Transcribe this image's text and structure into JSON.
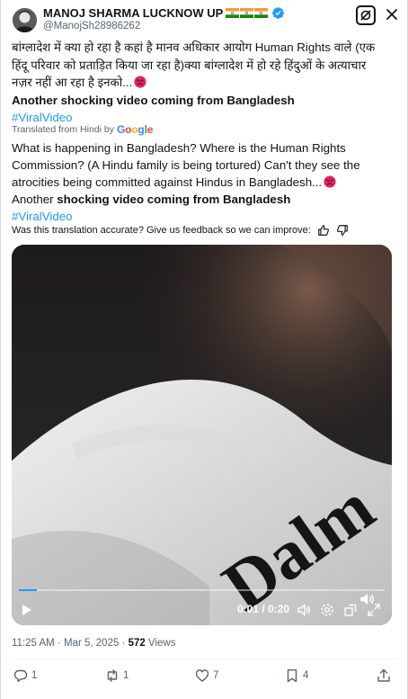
{
  "header": {
    "display_name": "MANOJ SHARMA LUCKNOW UP",
    "handle": "@ManojSh28986262",
    "avatar_icon": "profile-photo",
    "verified_icon": "verified-badge-icon",
    "grok_icon": "grok-icon",
    "close_icon": "close-icon"
  },
  "post": {
    "original_text": "बांग्लादेश में क्या हो रहा है कहां है मानव अधिकार आयोग Human Rights वाले (एक\nहिंदू परिवार को प्रताड़ित किया जा रहा है)क्या बांग्लादेश में हो रहे हिंदुओं के अत्याचार\nनज़र नहीं आ रहा है इनको...",
    "original_bold": "Another shocking video coming from Bangladesh",
    "original_hashtag": "#ViralVideo",
    "translated_prefix": "Translated from Hindi by",
    "translated_by": "Google",
    "translated_text": "What is happening in Bangladesh? Where is the Human Rights\nCommission? (A Hindu family is being tortured) Can't they see the\natrocities being committed against Hindus in Bangladesh...",
    "translated_line_start": "Another ",
    "translated_bold": "shocking video coming from Bangladesh",
    "translated_hashtag": "#ViralVideo",
    "feedback_prompt": "Was this translation accurate? Give us feedback so we can improve:"
  },
  "video": {
    "time_display": "0:01 / 0:20",
    "progress": 0.05,
    "overlay_text": "Dalm"
  },
  "meta": {
    "time": "11:25 AM",
    "date": "Mar 5, 2025",
    "separator": "·",
    "views_count": "572",
    "views_label": "Views"
  },
  "actions": {
    "replies": "1",
    "reposts": "1",
    "likes": "7",
    "bookmarks": "4"
  },
  "colors": {
    "accent": "#1d9bf0",
    "secondary_text": "#536471",
    "primary_text": "#0f1419"
  }
}
